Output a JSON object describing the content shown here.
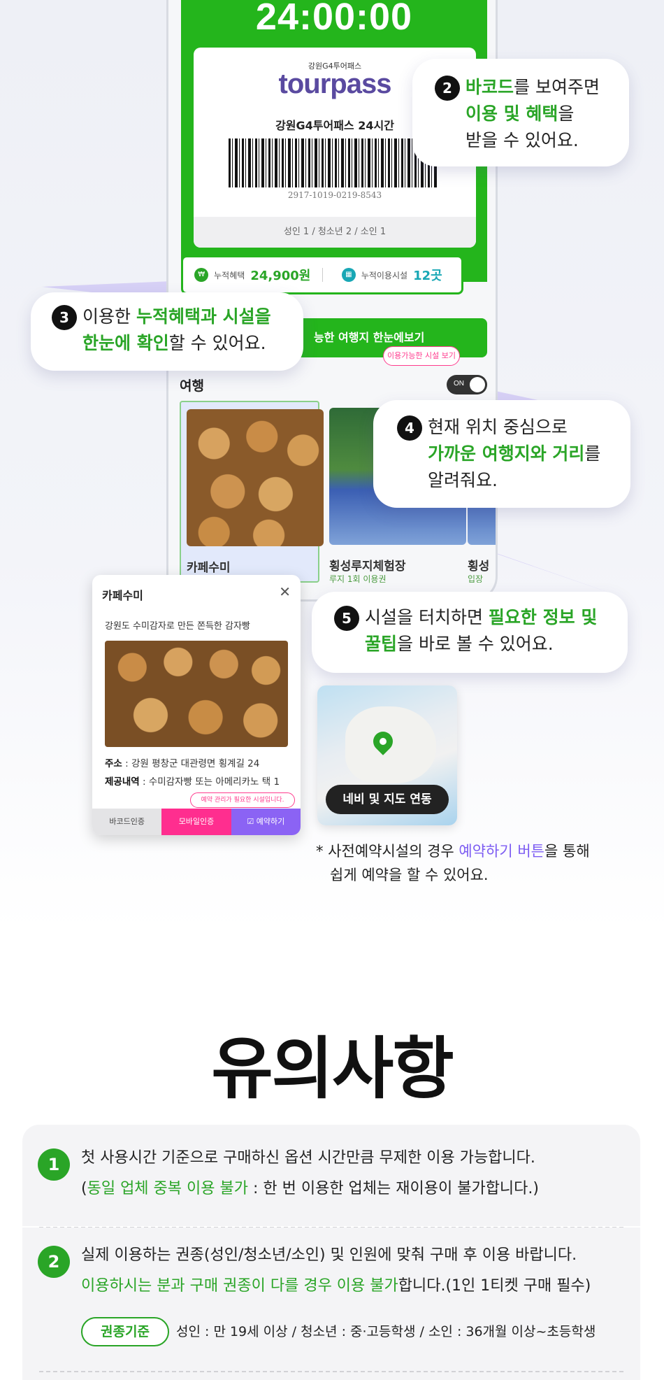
{
  "phone": {
    "timer": "24:00:00",
    "brand_sub": "강원G4투어패스",
    "brand_logo": "tourpass",
    "pass_title": "강원G4투어패스 24시간",
    "barcode_number": "2917-1019-0219-8543",
    "passengers": "성인 1 / 청소년 2 / 소인 1",
    "stats": {
      "benefit_label": "누적혜택",
      "benefit_value": "24,900원",
      "facility_label": "누적이용시설",
      "facility_value": "12곳"
    },
    "nearby_bar": "능한 여행지 한눈에보기",
    "travel_label": "여행",
    "toggle_tip": "이용가능한 시설 보기",
    "toggle_state": "ON",
    "cards": [
      {
        "name": "카페수미",
        "sub": ""
      },
      {
        "name": "횡성루지체험장",
        "sub": "루지 1회 이용권"
      },
      {
        "name": "횡성",
        "sub": "입장"
      }
    ]
  },
  "callouts": {
    "c2": {
      "num": "2",
      "line1_hl": "바코드",
      "line1_rest": "를 보여주면",
      "line2_hl": "이용 및 혜택",
      "line2_rest": "을",
      "line3": "받을 수 있어요."
    },
    "c3": {
      "num": "3",
      "line1_pre": "이용한 ",
      "line1_hl": "누적혜택과 시설을",
      "line2_hl": "한눈에 확인",
      "line2_rest": "할 수 있어요."
    },
    "c4": {
      "num": "4",
      "line1": "현재 위치 중심으로",
      "line2_hl": "가까운 여행지와 거리",
      "line2_rest": "를",
      "line3": "알려줘요."
    },
    "c5": {
      "num": "5",
      "line1_pre": "시설을 터치하면 ",
      "line1_hl": "필요한 정보 및",
      "line2_hl": "꿀팁",
      "line2_rest": "을 바로 볼 수 있어요."
    }
  },
  "popup": {
    "title": "카페수미",
    "close": "✕",
    "desc": "강원도 수미감자로 만든 쫀득한 감자빵",
    "address_label": "주소",
    "address": " : 강원 평창군 대관령면 횡계길 24",
    "offer_label": "제공내역",
    "offer": " : 수미감자빵 또는 아메리카노 택 1",
    "tip": "예약 관리가 필요한 시설입니다.",
    "btn_barcode": "바코드인증",
    "btn_mobile": "모바일인증",
    "btn_reserve": "예약하기"
  },
  "map": {
    "label": "네비 및 지도 연동"
  },
  "note": {
    "line1_pre": "* 사전예약시설의 경우 ",
    "line1_hl": "예약하기 버튼",
    "line1_rest": "을 통해",
    "line2": "쉽게 예약을 할 수 있어요."
  },
  "notices": {
    "title": "유의사항",
    "items": [
      {
        "num": "1",
        "line1": "첫 사용시간 기준으로 구매하신 옵션 시간만큼 무제한 이용 가능합니다.",
        "line2_pre": "(",
        "line2_hl": "동일 업체 중복 이용 불가",
        "line2_rest": " : 한 번 이용한 업체는 재이용이 불가합니다.)"
      },
      {
        "num": "2",
        "line1": "실제 이용하는 권종(성인/청소년/소인) 및 인원에 맞춰 구매 후 이용 바랍니다.",
        "line2_hl": "이용하시는 분과 구매 권종이 다를 경우 이용 불가",
        "line2_rest": "합니다.(1인 1티켓 구매 필수)",
        "pill": "권종기준",
        "pill_text": "성인 : 만 19세 이상 / 청소년 : 중·고등학생 / 소인 : 36개월 이상~초등학생"
      }
    ]
  },
  "colors": {
    "accent_green": "#2aa527",
    "accent_purple": "#7c5cf2",
    "accent_pink": "#ff2e8f"
  }
}
